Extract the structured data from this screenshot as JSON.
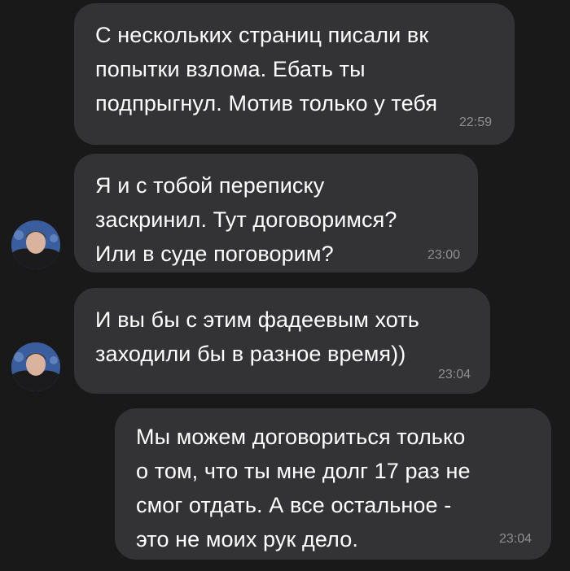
{
  "messages": [
    {
      "text": "С нескольких страниц писали вк\nпопытки взлома. Ебать ты\nподпрыгнул. Мотив только у тебя",
      "time": "22:59",
      "sender": "other"
    },
    {
      "text": "Я и с тобой переписку\nзаскринил. Тут договоримся?\nИли в суде поговорим?",
      "time": "23:00",
      "sender": "other"
    },
    {
      "text": "И вы бы с этим фадеевым хоть\nзаходили бы в разное время))",
      "time": "23:04",
      "sender": "other"
    },
    {
      "text": "Мы можем договориться только\nо том, что ты мне долг 17 раз не\nсмог отдать. А все остальное -\nэто не моих рук дело.",
      "time": "23:04",
      "sender": "me"
    }
  ],
  "colors": {
    "background": "#19191a",
    "bubble": "#333335",
    "text": "#ffffff",
    "time": "#8e8e93"
  }
}
